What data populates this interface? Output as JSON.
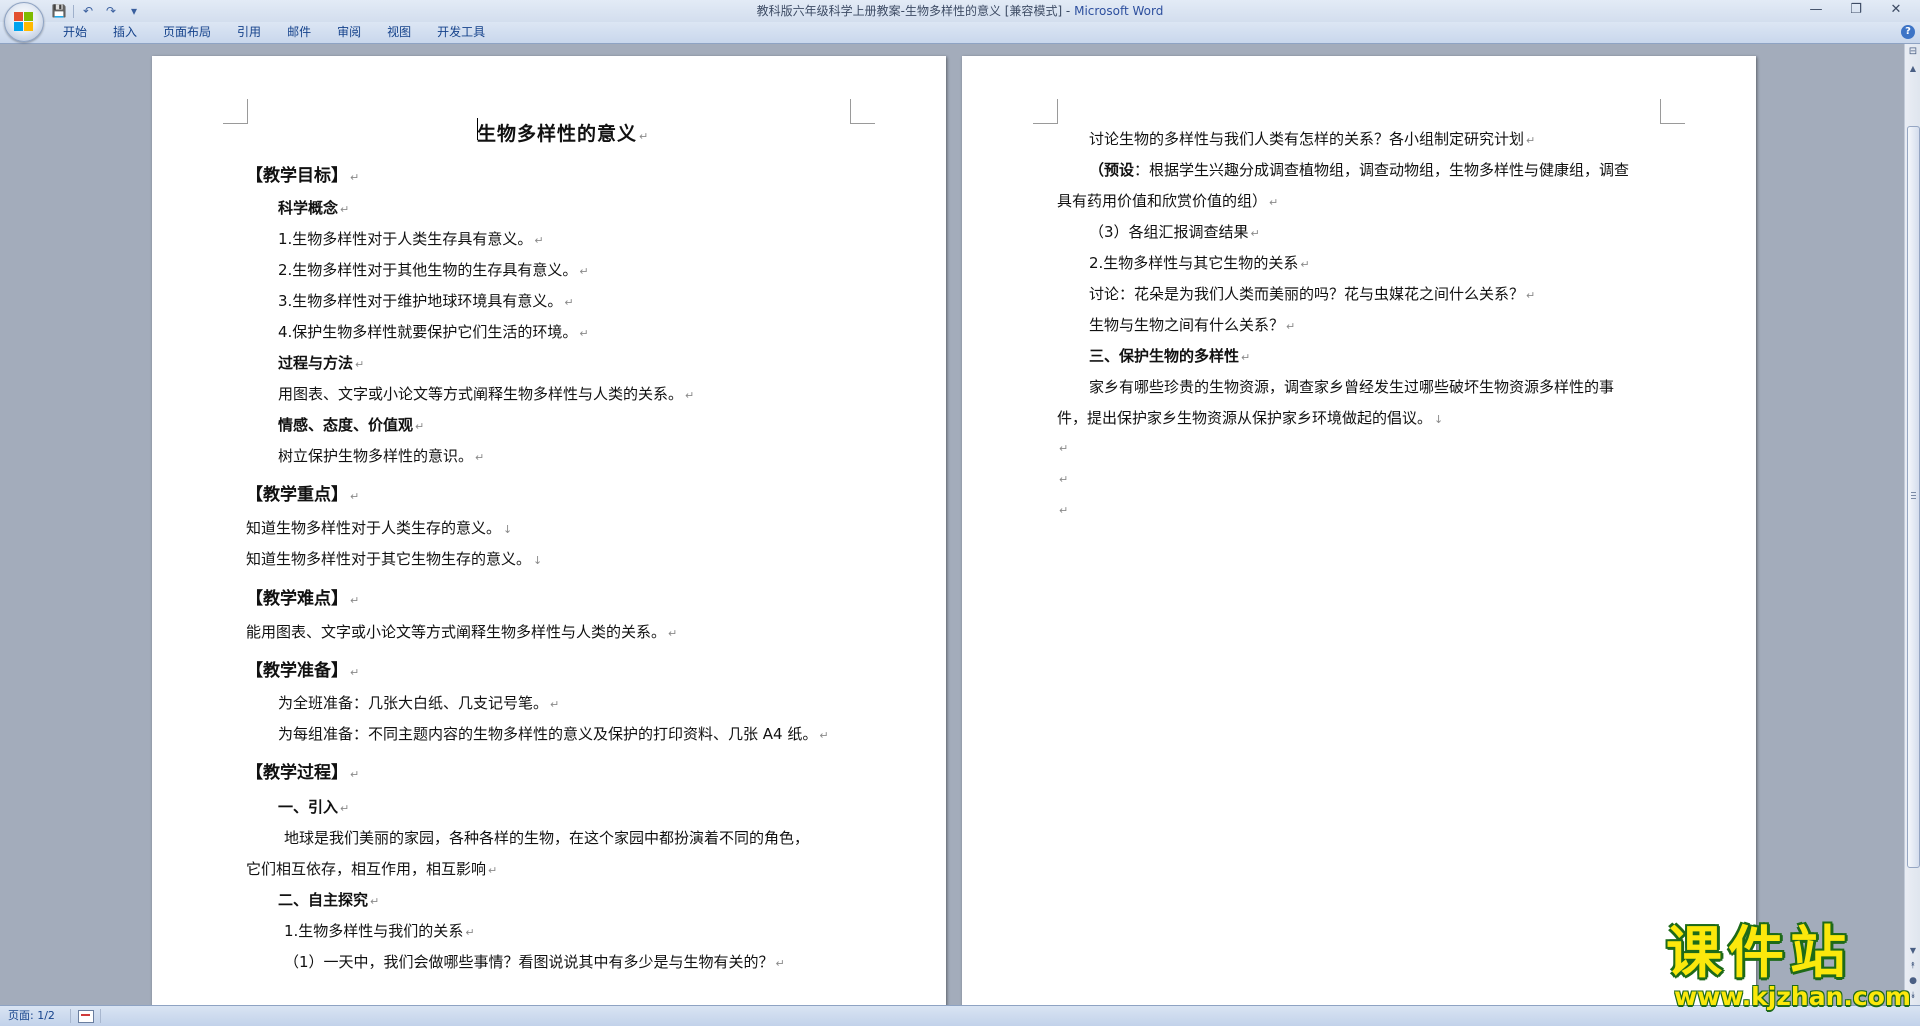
{
  "window": {
    "title": "教科版六年级科学上册教案-生物多样性的意义 [兼容模式] - ",
    "app_name": "Microsoft Word",
    "minimize_glyph": "—",
    "maximize_glyph": "❐",
    "close_glyph": "✕"
  },
  "quick_access": {
    "save_glyph": "💾",
    "undo_glyph": "↶",
    "redo_glyph": "↷",
    "customize_glyph": "▾"
  },
  "ribbon_tabs": [
    "开始",
    "插入",
    "页面布局",
    "引用",
    "邮件",
    "审阅",
    "视图",
    "开发工具"
  ],
  "help_glyph": "?",
  "page1_lines": [
    "生物多样性的意义",
    "【教学目标】",
    "科学概念",
    "1.生物多样性对于人类生存具有意义。",
    "2.生物多样性对于其他生物的生存具有意义。",
    "3.生物多样性对于维护地球环境具有意义。",
    "4.保护生物多样性就要保护它们生活的环境。",
    "过程与方法",
    "用图表、文字或小论文等方式阐释生物多样性与人类的关系。",
    "情感、态度、价值观",
    "树立保护生物多样性的意识。",
    "【教学重点】",
    "知道生物多样性对于人类生存的意义。",
    "知道生物多样性对于其它生物生存的意义。",
    "【教学难点】",
    "能用图表、文字或小论文等方式阐释生物多样性与人类的关系。",
    "【教学准备】",
    "为全班准备：几张大白纸、几支记号笔。",
    "为每组准备：不同主题内容的生物多样性的意义及保护的打印资料、几张 A4 纸。",
    "【教学过程】",
    "一、引入",
    "地球是我们美丽的家园，各种各样的生物，在这个家园中都扮演着不同的角色，",
    "它们相互依存，相互作用，相互影响",
    "二、自主探究",
    "1.生物多样性与我们的关系",
    "（1）一天中，我们会做哪些事情？看图说说其中有多少是与生物有关的？"
  ],
  "page2_lines": [
    "讨论生物的多样性与我们人类有怎样的关系？各小组制定研究计划",
    "（预设",
    "：根据学生兴趣分成调查植物组，调查动物组，生物多样性与健康组，调查",
    "具有药用价值和欣赏价值的组）",
    "（3）各组汇报调查结果",
    "2.生物多样性与其它生物的关系",
    "讨论：花朵是为我们人类而美丽的吗？花与虫媒花之间什么关系？",
    "生物与生物之间有什么关系？",
    "三、保护生物的多样性",
    "家乡有哪些珍贵的生物资源，调查家乡曾经发生过哪些破坏生物资源多样性的事",
    "件，提出保护家乡生物资源从保护家乡环境做起的倡议。"
  ],
  "para_mark": "↵",
  "line_break_mark": "↓",
  "scrollbar": {
    "ruler_glyph": "⊟",
    "up_glyph": "▲",
    "down_glyph": "▼",
    "prev_glyph": "⯭",
    "select_glyph": "●",
    "next_glyph": "⯯"
  },
  "status": {
    "page_label": "页面: 1/2"
  },
  "watermark": {
    "text_cn": "课件站",
    "url": "www.kjzhan.com"
  },
  "colors": {
    "app_name": "#2d4f9e",
    "watermark_fill": "#fbe80c",
    "watermark_outline": "#1e6a18",
    "workspace": "#a3acbb"
  }
}
